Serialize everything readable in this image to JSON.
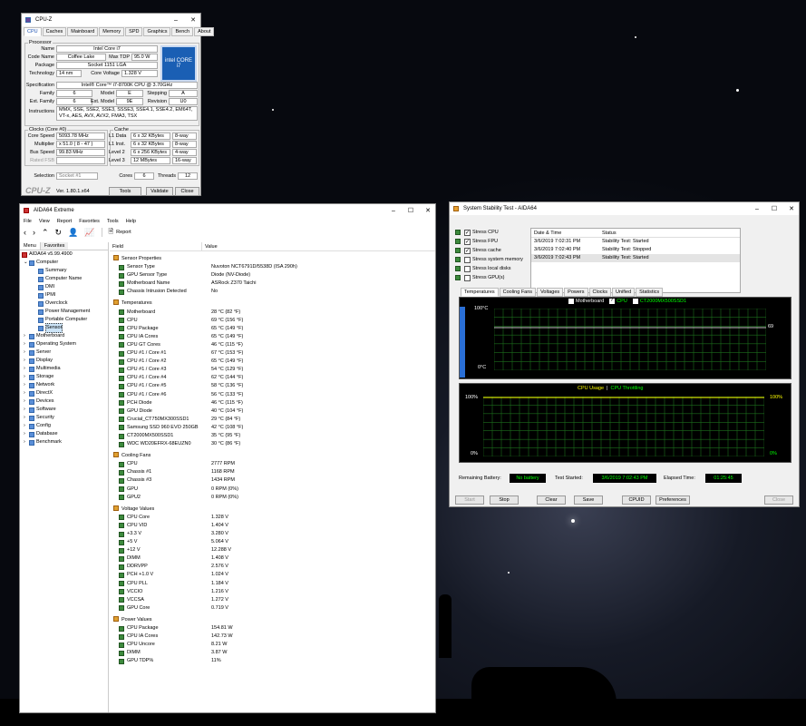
{
  "cpuz": {
    "title": "CPU-Z",
    "tabs": [
      "CPU",
      "Caches",
      "Mainboard",
      "Memory",
      "SPD",
      "Graphics",
      "Bench",
      "About"
    ],
    "processor_label": "Processor",
    "name_l": "Name",
    "name": "Intel Core i7",
    "codename_l": "Code Name",
    "codename": "Coffee Lake",
    "maxtdp_l": "Max TDP",
    "maxtdp": "95.0 W",
    "package_l": "Package",
    "package": "Socket 1151 LGA",
    "tech_l": "Technology",
    "tech": "14 nm",
    "cvolt_l": "Core Voltage",
    "cvolt": "1.328 V",
    "spec_l": "Specification",
    "spec": "Intel® Core™ i7-8700K CPU @ 3.70GHz",
    "family_l": "Family",
    "family": "6",
    "model_l": "Model",
    "model": "E",
    "stepping_l": "Stepping",
    "stepping": "A",
    "extfam_l": "Ext. Family",
    "extfam": "6",
    "extmod_l": "Ext. Model",
    "extmod": "9E",
    "rev_l": "Revision",
    "rev": "U0",
    "instr_l": "Instructions",
    "instr": "MMX, SSE, SSE2, SSE3, SSSE3, SSE4.1, SSE4.2, EM64T, VT-x, AES, AVX, AVX2, FMA3, TSX",
    "clocks_l": "Clocks (Core #0)",
    "cspeed_l": "Core Speed",
    "cspeed": "5093.78 MHz",
    "mult_l": "Multiplier",
    "mult": "x 51.0 ( 8 - 47 )",
    "bus_l": "Bus Speed",
    "bus": "99.83 MHz",
    "fsb_l": "Rated FSB",
    "cache_l": "Cache",
    "l1d_l": "L1 Data",
    "l1d": "6 x 32 KBytes",
    "l1d_w": "8-way",
    "l1i_l": "L1 Inst.",
    "l1i": "6 x 32 KBytes",
    "l1i_w": "8-way",
    "l2_l": "Level 2",
    "l2": "6 x 256 KBytes",
    "l2_w": "4-way",
    "l3_l": "Level 3",
    "l3": "12 MBytes",
    "l3_w": "16-way",
    "sel_l": "Selection",
    "sel": "Socket #1",
    "cores_l": "Cores",
    "cores": "6",
    "threads_l": "Threads",
    "threads": "12",
    "logo": "CPU-Z",
    "ver": "Ver. 1.80.1.x64",
    "tools": "Tools",
    "validate": "Validate",
    "close": "Close",
    "badge": "intel CORE i7"
  },
  "aida": {
    "title": "AIDA64 Extreme",
    "menu": [
      "File",
      "View",
      "Report",
      "Favorites",
      "Tools",
      "Help"
    ],
    "report": "Report",
    "tab_menu": "Menu",
    "tab_fav": "Favorites",
    "tree": [
      {
        "t": "AIDA64 v5.99.4900",
        "d": 0
      },
      {
        "t": "Computer",
        "d": 1
      },
      {
        "t": "Summary",
        "d": 2
      },
      {
        "t": "Computer Name",
        "d": 2
      },
      {
        "t": "DMI",
        "d": 2
      },
      {
        "t": "IPMI",
        "d": 2
      },
      {
        "t": "Overclock",
        "d": 2
      },
      {
        "t": "Power Management",
        "d": 2
      },
      {
        "t": "Portable Computer",
        "d": 2
      },
      {
        "t": "Sensor",
        "d": 2
      },
      {
        "t": "Motherboard",
        "d": 1
      },
      {
        "t": "Operating System",
        "d": 1
      },
      {
        "t": "Server",
        "d": 1
      },
      {
        "t": "Display",
        "d": 1
      },
      {
        "t": "Multimedia",
        "d": 1
      },
      {
        "t": "Storage",
        "d": 1
      },
      {
        "t": "Network",
        "d": 1
      },
      {
        "t": "DirectX",
        "d": 1
      },
      {
        "t": "Devices",
        "d": 1
      },
      {
        "t": "Software",
        "d": 1
      },
      {
        "t": "Security",
        "d": 1
      },
      {
        "t": "Config",
        "d": 1
      },
      {
        "t": "Database",
        "d": 1
      },
      {
        "t": "Benchmark",
        "d": 1
      }
    ],
    "col_field": "Field",
    "col_value": "Value",
    "rows": [
      {
        "s": "Sensor Properties"
      },
      {
        "f": "Sensor Type",
        "v": "Nuvoton NCT6791D/5538D  (ISA 290h)"
      },
      {
        "f": "GPU Sensor Type",
        "v": "Diode  (NV-Diode)"
      },
      {
        "f": "Motherboard Name",
        "v": "ASRock Z370 Taichi"
      },
      {
        "f": "Chassis Intrusion Detected",
        "v": "No"
      },
      {
        "s": "Temperatures"
      },
      {
        "f": "Motherboard",
        "v": "28 °C  (82 °F)"
      },
      {
        "f": "CPU",
        "v": "69 °C  (156 °F)"
      },
      {
        "f": "CPU Package",
        "v": "65 °C  (149 °F)"
      },
      {
        "f": "CPU IA Cores",
        "v": "65 °C  (149 °F)"
      },
      {
        "f": "CPU GT Cores",
        "v": "46 °C  (115 °F)"
      },
      {
        "f": "CPU #1 / Core #1",
        "v": "67 °C  (153 °F)"
      },
      {
        "f": "CPU #1 / Core #2",
        "v": "65 °C  (149 °F)"
      },
      {
        "f": "CPU #1 / Core #3",
        "v": "54 °C  (129 °F)"
      },
      {
        "f": "CPU #1 / Core #4",
        "v": "62 °C  (144 °F)"
      },
      {
        "f": "CPU #1 / Core #5",
        "v": "58 °C  (136 °F)"
      },
      {
        "f": "CPU #1 / Core #6",
        "v": "56 °C  (133 °F)"
      },
      {
        "f": "PCH Diode",
        "v": "46 °C  (115 °F)"
      },
      {
        "f": "GPU Diode",
        "v": "40 °C  (104 °F)"
      },
      {
        "f": "Crucial_CT750MX300SSD1",
        "v": "29 °C  (84 °F)"
      },
      {
        "f": "Samsung SSD 960 EVO 250GB",
        "v": "42 °C  (108 °F)"
      },
      {
        "f": "CT2000MX500SSD1",
        "v": "35 °C  (95 °F)"
      },
      {
        "f": "WDC WD20EFRX-68EUZN0",
        "v": "30 °C  (86 °F)"
      },
      {
        "s": "Cooling Fans"
      },
      {
        "f": "CPU",
        "v": "2777 RPM"
      },
      {
        "f": "Chassis #1",
        "v": "1168 RPM"
      },
      {
        "f": "Chassis #3",
        "v": "1434 RPM"
      },
      {
        "f": "GPU",
        "v": "0 RPM  (0%)"
      },
      {
        "f": "GPU2",
        "v": "0 RPM  (0%)"
      },
      {
        "s": "Voltage Values"
      },
      {
        "f": "CPU Core",
        "v": "1.328 V"
      },
      {
        "f": "CPU VID",
        "v": "1.404 V"
      },
      {
        "f": "+3.3 V",
        "v": "3.280 V"
      },
      {
        "f": "+5 V",
        "v": "5.064 V"
      },
      {
        "f": "+12 V",
        "v": "12.288 V"
      },
      {
        "f": "DIMM",
        "v": "1.408 V"
      },
      {
        "f": "DDRVPP",
        "v": "2.576 V"
      },
      {
        "f": "PCH +1.0 V",
        "v": "1.024 V"
      },
      {
        "f": "CPU PLL",
        "v": "1.184 V"
      },
      {
        "f": "VCCIO",
        "v": "1.216 V"
      },
      {
        "f": "VCCSA",
        "v": "1.272 V"
      },
      {
        "f": "GPU Core",
        "v": "0.719 V"
      },
      {
        "s": "Power Values"
      },
      {
        "f": "CPU Package",
        "v": "154.81 W"
      },
      {
        "f": "CPU IA Cores",
        "v": "142.73 W"
      },
      {
        "f": "CPU Uncore",
        "v": "8.21 W"
      },
      {
        "f": "DIMM",
        "v": "3.87 W"
      },
      {
        "f": "GPU TDP%",
        "v": "11%"
      }
    ]
  },
  "sst": {
    "title": "System Stability Test - AIDA64",
    "checks": [
      {
        "t": "Stress CPU",
        "c": true
      },
      {
        "t": "Stress FPU",
        "c": true
      },
      {
        "t": "Stress cache",
        "c": true
      },
      {
        "t": "Stress system memory",
        "c": false
      },
      {
        "t": "Stress local disks",
        "c": false
      },
      {
        "t": "Stress GPU(s)",
        "c": false
      }
    ],
    "log_h1": "Date & Time",
    "log_h2": "Status",
    "log": [
      {
        "d": "3/6/2019 7:02:31 PM",
        "s": "Stability Test: Started"
      },
      {
        "d": "3/6/2019 7:02:40 PM",
        "s": "Stability Test: Stopped"
      },
      {
        "d": "3/6/2019 7:02:43 PM",
        "s": "Stability Test: Started"
      }
    ],
    "tabs": [
      "Temperatures",
      "Cooling Fans",
      "Voltages",
      "Powers",
      "Clocks",
      "Unified",
      "Statistics"
    ],
    "legend": [
      "Motherboard",
      "CPU",
      "CT2000MX500SSD1"
    ],
    "g1_top": "100°C",
    "g1_bot": "0°C",
    "g1_val": "69",
    "g2_t1": "CPU Usage",
    "g2_sep": "|",
    "g2_t2": "CPU Throttling",
    "g2_top": "100%",
    "g2_bot": "0%",
    "g2_rtop": "100%",
    "g2_rbot": "0%",
    "batt_l": "Remaining Battery:",
    "batt": "No battery",
    "start_l": "Test Started:",
    "start": "3/6/2019 7:02:43 PM",
    "elap_l": "Elapsed Time:",
    "elap": "01:25:45",
    "b_start": "Start",
    "b_stop": "Stop",
    "b_clear": "Clear",
    "b_save": "Save",
    "b_cpuid": "CPUID",
    "b_pref": "Preferences",
    "b_close": "Close"
  }
}
